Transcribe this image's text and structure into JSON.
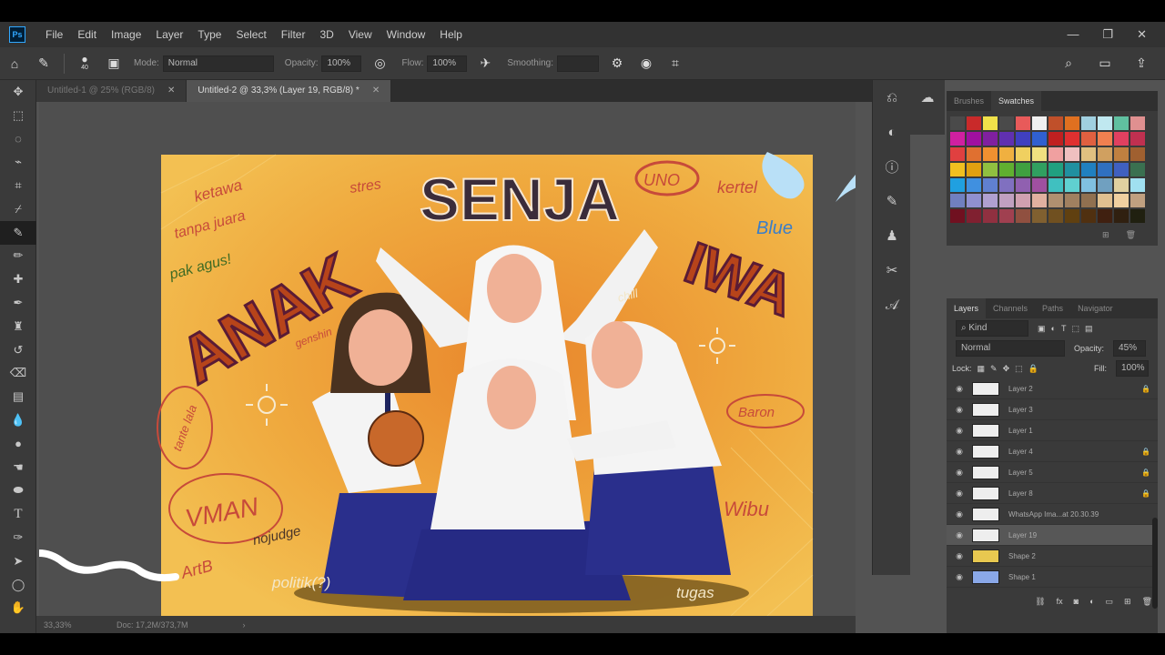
{
  "app": {
    "logo": "Ps"
  },
  "menu": [
    "File",
    "Edit",
    "Image",
    "Layer",
    "Type",
    "Select",
    "Filter",
    "3D",
    "View",
    "Window",
    "Help"
  ],
  "window_controls": [
    "—",
    "❐",
    "✕"
  ],
  "options": {
    "mode_label": "Mode:",
    "mode_value": "Normal",
    "opacity_label": "Opacity:",
    "opacity_value": "100%",
    "flow_label": "Flow:",
    "flow_value": "100%",
    "smoothing_label": "Smoothing:",
    "brush_size": "40"
  },
  "tabs": [
    {
      "label": "Untitled-1 @ 25% (RGB/8)",
      "active": false
    },
    {
      "label": "Untitled-2 @ 33,3% (Layer 19, RGB/8) *",
      "active": true
    }
  ],
  "status": {
    "zoom": "33,33%",
    "doc": "Doc: 17,2M/373,7M"
  },
  "artwork": {
    "title": "SENJA",
    "left_word": "ANAK",
    "right_word": "IWA",
    "doodles": [
      "ketawa",
      "tanpa juara",
      "pak agus!",
      "stres",
      "UNO",
      "kertel",
      "Blue",
      "genshin",
      "chill",
      "tante lala",
      "Baron",
      "VMAN",
      "nojudge",
      "Wibu",
      "ArtB",
      "politik(?)",
      "tugas"
    ]
  },
  "panels": {
    "top_tabs": [
      "Brushes",
      "Swatches"
    ],
    "layer_tabs": [
      "Layers",
      "Channels",
      "Paths",
      "Navigator"
    ],
    "kind_label": "Kind",
    "blend_mode": "Normal",
    "opacity_label": "Opacity:",
    "opacity_value": "45%",
    "lock_label": "Lock:",
    "fill_label": "Fill:",
    "fill_value": "100%",
    "layers": [
      {
        "name": "Layer 2",
        "locked": true,
        "selected": false
      },
      {
        "name": "Layer 3",
        "locked": false,
        "selected": false
      },
      {
        "name": "Layer 1",
        "locked": false,
        "selected": false
      },
      {
        "name": "Layer 4",
        "locked": true,
        "selected": false
      },
      {
        "name": "Layer 5",
        "locked": true,
        "selected": false
      },
      {
        "name": "Layer 8",
        "locked": true,
        "selected": false
      },
      {
        "name": "WhatsApp Ima...at 20.30.39",
        "locked": false,
        "selected": false
      },
      {
        "name": "Layer 19",
        "locked": false,
        "selected": true
      },
      {
        "name": "Shape 2",
        "locked": false,
        "selected": false
      },
      {
        "name": "Shape 1",
        "locked": false,
        "selected": false
      }
    ]
  },
  "colors": {
    "accent": "#31a8ff",
    "canvas_bg": "#f1b742"
  }
}
